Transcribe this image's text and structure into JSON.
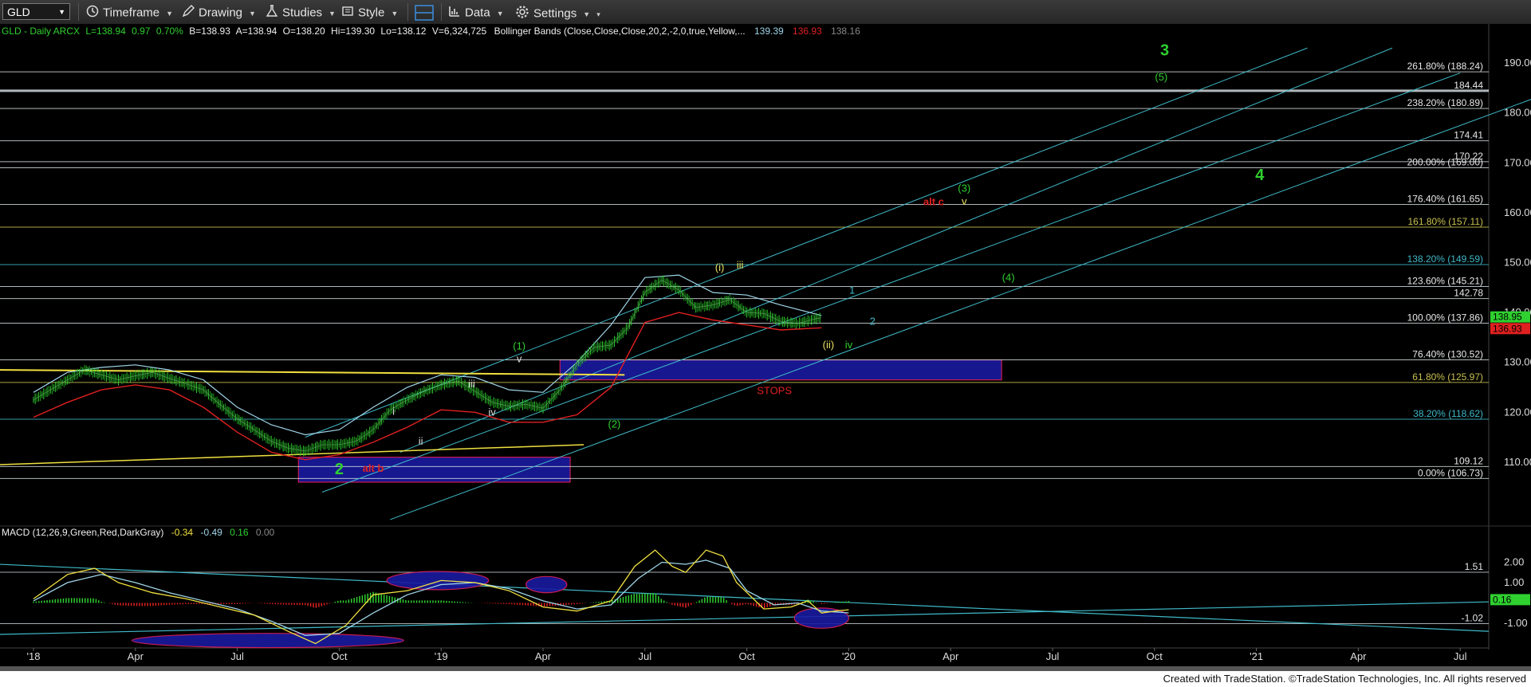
{
  "toolbar": {
    "symbol": "GLD",
    "timeframe_label": "Timeframe",
    "drawing_label": "Drawing",
    "studies_label": "Studies",
    "style_label": "Style",
    "data_label": "Data",
    "settings_label": "Settings"
  },
  "header": {
    "title": "GLD - Daily  ARCX",
    "L": "L=138.94",
    "chg": "0.97",
    "pct": "0.70%",
    "B": "B=138.93",
    "A": "A=138.94",
    "O": "O=138.20",
    "Hi": "Hi=139.30",
    "Lo": "Lo=138.12",
    "V": "V=6,324,725",
    "bb": "Bollinger Bands (Close,Close,Close,20,2,-2,0,true,Yellow,...",
    "bb_upper": "139.39",
    "bb_lower": "136.93",
    "bb_mid": "138.16"
  },
  "macd_header": {
    "title": "MACD (12,26,9,Green,Red,DarkGray)",
    "macd": "-0.34",
    "signal": "-0.49",
    "hist": "0.16",
    "zero": "0.00"
  },
  "footer_text": "Created with TradeStation. ©TradeStation Technologies, Inc. All rights reserved",
  "colors": {
    "up": "#2fd02f",
    "down": "#e02020",
    "bb_upper": "#9fd4e8",
    "bb_lower": "#e02020",
    "fib": "#cfd8dc",
    "channel": "#3fb9c8",
    "trend": "#f0e040",
    "zone": "#1a1aa0",
    "zone_border": "#e0205a"
  },
  "chart_data": [
    {
      "type": "line",
      "title": "GLD - Daily",
      "x_labels": [
        "'18",
        "Apr",
        "Jul",
        "Oct",
        "'19",
        "Apr",
        "Jul",
        "Oct",
        "'20",
        "Apr",
        "Jul",
        "Oct",
        "'21",
        "Apr",
        "Jul"
      ],
      "y_ticks": [
        110,
        120,
        130,
        140,
        150,
        160,
        170,
        180,
        190
      ],
      "ylim": [
        102,
        194
      ],
      "series": [
        {
          "name": "GLD",
          "x_month": [
            0,
            0.5,
            1,
            1.5,
            2,
            2.5,
            3,
            3.5,
            4,
            4.5,
            5,
            5.5,
            6,
            6.5,
            7,
            7.5,
            8,
            8.5,
            9,
            9.5,
            10,
            10.5,
            11,
            11.5,
            12,
            12.5,
            13,
            13.5,
            14,
            14.5,
            15,
            15.5,
            16,
            16.5,
            17,
            17.5,
            18,
            18.5,
            19,
            19.5,
            20,
            20.5,
            21,
            21.5,
            22,
            22.5,
            23,
            23.2
          ],
          "y": [
            122.5,
            124.5,
            126.5,
            128.5,
            127.5,
            126.5,
            127.3,
            128,
            126.8,
            125.7,
            124.5,
            121.5,
            118.7,
            116.5,
            114.2,
            112.8,
            112.2,
            113.5,
            113.5,
            114.2,
            116.5,
            120.5,
            122.5,
            124.2,
            125.5,
            126.3,
            124.2,
            122,
            121.2,
            121.6,
            120.8,
            124.5,
            129.5,
            133,
            133.5,
            137,
            144,
            146.5,
            144.5,
            141,
            141.5,
            142.6,
            140,
            139.8,
            138.2,
            137.8,
            138.7,
            138.95
          ]
        },
        {
          "name": "BB Upper",
          "x_month": [
            0,
            1,
            2,
            3,
            4,
            5,
            6,
            7,
            8,
            9,
            10,
            11,
            12,
            13,
            14,
            15,
            16,
            17,
            18,
            19,
            20,
            21,
            22,
            23.2
          ],
          "y": [
            124,
            128,
            129,
            129.5,
            128.5,
            126.5,
            121,
            117.5,
            115.5,
            116.5,
            121,
            125,
            127.5,
            127,
            124.5,
            124,
            130,
            137.5,
            147,
            147.5,
            144,
            143.5,
            141.5,
            139.39
          ]
        },
        {
          "name": "BB Lower",
          "x_month": [
            0,
            1,
            2,
            3,
            4,
            5,
            6,
            7,
            8,
            9,
            10,
            11,
            12,
            13,
            14,
            15,
            16,
            17,
            18,
            19,
            20,
            21,
            22,
            23.2
          ],
          "y": [
            119,
            122,
            124.5,
            125.5,
            124.5,
            121,
            116,
            112,
            110.5,
            111.5,
            114,
            117,
            120.5,
            120,
            118,
            118,
            119.5,
            125,
            138,
            140,
            138.5,
            137.5,
            136.5,
            136.93
          ]
        }
      ],
      "levels": [
        {
          "label": "261.80% (188.24)",
          "value": 188.24
        },
        {
          "label": "184.44",
          "value": 184.44
        },
        {
          "label": "238.20% (180.89)",
          "value": 180.89
        },
        {
          "label": "174.41",
          "value": 174.41
        },
        {
          "label": "170.22",
          "value": 170.22
        },
        {
          "label": "200.00% (169.00)",
          "value": 169.0
        },
        {
          "label": "176.40% (161.65)",
          "value": 161.65
        },
        {
          "label": "161.80% (157.11)",
          "value": 157.11
        },
        {
          "label": "138.20% (149.59)",
          "value": 149.59
        },
        {
          "label": "123.60% (145.21)",
          "value": 145.21
        },
        {
          "label": "142.78",
          "value": 142.78
        },
        {
          "label": "100.00% (137.86)",
          "value": 137.86
        },
        {
          "label": "76.40% (130.52)",
          "value": 130.52
        },
        {
          "label": "61.80% (125.97)",
          "value": 125.97
        },
        {
          "label": "38.20% (118.62)",
          "value": 118.62
        },
        {
          "label": "109.12",
          "value": 109.12
        },
        {
          "label": "0.00% (106.73)",
          "value": 106.73
        }
      ],
      "last_price_tags": [
        "138.95",
        "136.93"
      ],
      "zones": [
        {
          "label": "STOPS",
          "x_month": [
            15.5,
            28.5
          ],
          "y": [
            126.5,
            130.5
          ]
        },
        {
          "label": "",
          "x_month": [
            7.8,
            15.8
          ],
          "y": [
            106,
            111
          ]
        }
      ],
      "wave_labels": [
        {
          "text": "3",
          "x_month": 33.3,
          "y": 191.5,
          "color": "green",
          "size": "large"
        },
        {
          "text": "(5)",
          "x_month": 33.2,
          "y": 186.5,
          "color": "green"
        },
        {
          "text": "4",
          "x_month": 36.1,
          "y": 166.5,
          "color": "green",
          "size": "large"
        },
        {
          "text": "alt c",
          "x_month": 26.5,
          "y": 161.5,
          "color": "red"
        },
        {
          "text": "(3)",
          "x_month": 27.4,
          "y": 164.2,
          "color": "green"
        },
        {
          "text": "v",
          "x_month": 27.4,
          "y": 161.6,
          "color": "yellow"
        },
        {
          "text": "(4)",
          "x_month": 28.7,
          "y": 146.3,
          "color": "green"
        },
        {
          "text": "1",
          "x_month": 24.1,
          "y": 143.8,
          "color": "cyan"
        },
        {
          "text": "2",
          "x_month": 24.7,
          "y": 137.5,
          "color": "cyan"
        },
        {
          "text": "iv",
          "x_month": 24.0,
          "y": 132.8,
          "color": "green"
        },
        {
          "text": "(ii)",
          "x_month": 23.4,
          "y": 132.8,
          "color": "yellow"
        },
        {
          "text": "(i)",
          "x_month": 20.2,
          "y": 148.3,
          "color": "yellow"
        },
        {
          "text": "iii",
          "x_month": 20.8,
          "y": 148.8,
          "color": "yellow"
        },
        {
          "text": "(1)",
          "x_month": 14.3,
          "y": 132.6,
          "color": "green"
        },
        {
          "text": "v",
          "x_month": 14.3,
          "y": 130.0,
          "color": "white"
        },
        {
          "text": "iii",
          "x_month": 12.9,
          "y": 125.0,
          "color": "white"
        },
        {
          "text": "iv",
          "x_month": 13.5,
          "y": 119.3,
          "color": "white"
        },
        {
          "text": "i",
          "x_month": 10.6,
          "y": 119.5,
          "color": "white"
        },
        {
          "text": "ii",
          "x_month": 11.4,
          "y": 113.5,
          "color": "white"
        },
        {
          "text": "(2)",
          "x_month": 17.1,
          "y": 116.9,
          "color": "green"
        },
        {
          "text": "2",
          "x_month": 9.0,
          "y": 107.6,
          "color": "green",
          "size": "large"
        },
        {
          "text": "alt b",
          "x_month": 10.0,
          "y": 108.1,
          "color": "red"
        }
      ]
    },
    {
      "type": "line",
      "title": "MACD (12,26,9,Green,Red,DarkGray)",
      "y_ticks": [
        -1.0,
        1.0,
        2.0
      ],
      "ylim": [
        -2.1,
        3.0
      ],
      "levels": [
        {
          "label": "1.51",
          "value": 1.51
        },
        {
          "label": "-1.02",
          "value": -1.02
        }
      ],
      "last_value_tag": "0.16",
      "series": [
        {
          "name": "MACD",
          "x_month": [
            0,
            1,
            1.8,
            2.5,
            3.5,
            4.5,
            5.5,
            6.5,
            7.5,
            8.3,
            9.2,
            10,
            11,
            12,
            13,
            14,
            15,
            16,
            17,
            17.7,
            18.3,
            18.8,
            19.2,
            19.8,
            20.3,
            20.7,
            21.5,
            22.3,
            22.8,
            23.2,
            23.6,
            24.0
          ],
          "y": [
            0.2,
            1.4,
            1.7,
            1.0,
            0.5,
            0.2,
            -0.2,
            -0.6,
            -1.4,
            -2.0,
            -1.1,
            0.4,
            0.6,
            1.1,
            1.0,
            0.6,
            -0.2,
            -0.4,
            0.1,
            1.8,
            2.6,
            1.8,
            1.5,
            2.6,
            2.3,
            1.0,
            -0.3,
            -0.2,
            0.1,
            -0.5,
            -0.4,
            -0.34
          ]
        },
        {
          "name": "Signal",
          "x_month": [
            0,
            1,
            2,
            3,
            4,
            5,
            6,
            7,
            8,
            9,
            10,
            11,
            12,
            13,
            14,
            15,
            16,
            17,
            17.8,
            18.5,
            19.2,
            19.8,
            20.5,
            21,
            21.8,
            22.5,
            23.2,
            24.0
          ],
          "y": [
            0.1,
            1.0,
            1.4,
            1.0,
            0.5,
            0.1,
            -0.3,
            -0.9,
            -1.6,
            -1.5,
            -0.5,
            0.4,
            0.9,
            1.0,
            0.7,
            0.1,
            -0.3,
            -0.1,
            1.2,
            2.0,
            1.9,
            2.1,
            1.7,
            0.6,
            -0.1,
            0.0,
            -0.4,
            -0.49
          ]
        }
      ]
    }
  ]
}
